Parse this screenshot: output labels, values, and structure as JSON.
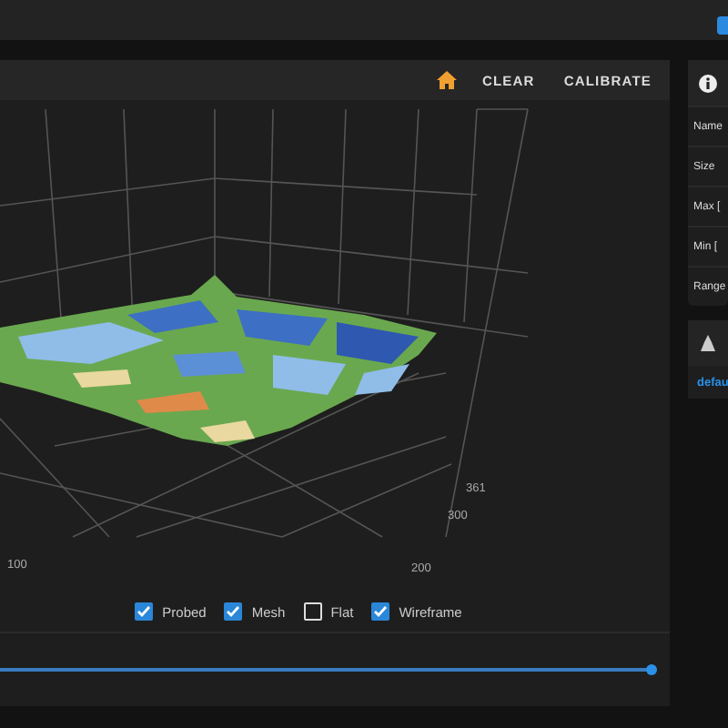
{
  "toolbar": {
    "buttons": [
      {
        "kind": "home"
      },
      {
        "kind": "text",
        "label": "CLEAR"
      },
      {
        "kind": "text",
        "label": "CALIBRATE"
      }
    ]
  },
  "axis_labels": [
    {
      "text": "361",
      "kind": "y"
    },
    {
      "text": "300",
      "kind": "y"
    },
    {
      "text": "200",
      "kind": "y"
    },
    {
      "text": "100",
      "kind": "x"
    }
  ],
  "options": [
    {
      "label": "Probed",
      "checked": true
    },
    {
      "label": "Mesh",
      "checked": true
    },
    {
      "label": "Flat",
      "checked": false
    },
    {
      "label": "Wireframe",
      "checked": true
    }
  ],
  "slider": {
    "level": 1
  },
  "info_panel": {
    "rows": [
      "Name",
      "Size",
      "Max [",
      "Min [",
      "Range"
    ]
  },
  "profiles_panel": {
    "items": [
      "defau"
    ]
  }
}
